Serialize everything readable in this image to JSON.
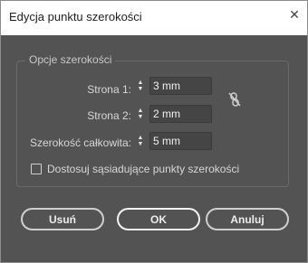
{
  "window": {
    "title": "Edycja punktu szerokości",
    "close_glyph": "✕"
  },
  "group": {
    "legend": "Opcje szerokości"
  },
  "fields": {
    "side1_label": "Strona 1:",
    "side1_value": "3 mm",
    "side2_label": "Strona 2:",
    "side2_value": "2 mm",
    "total_label": "Szerokość całkowita:",
    "total_value": "5 mm"
  },
  "checkbox": {
    "label": "Dostosuj sąsiadujące punkty szerokości",
    "checked": false
  },
  "buttons": {
    "delete_label": "Usuń",
    "ok_label": "OK",
    "cancel_label": "Anuluj"
  },
  "icons": {
    "link": "broken-link-icon",
    "spinner": "up-down-spinner-icon"
  },
  "colors": {
    "dialog_bg": "#535353",
    "field_bg": "#454545",
    "text": "#d7d7d7"
  }
}
